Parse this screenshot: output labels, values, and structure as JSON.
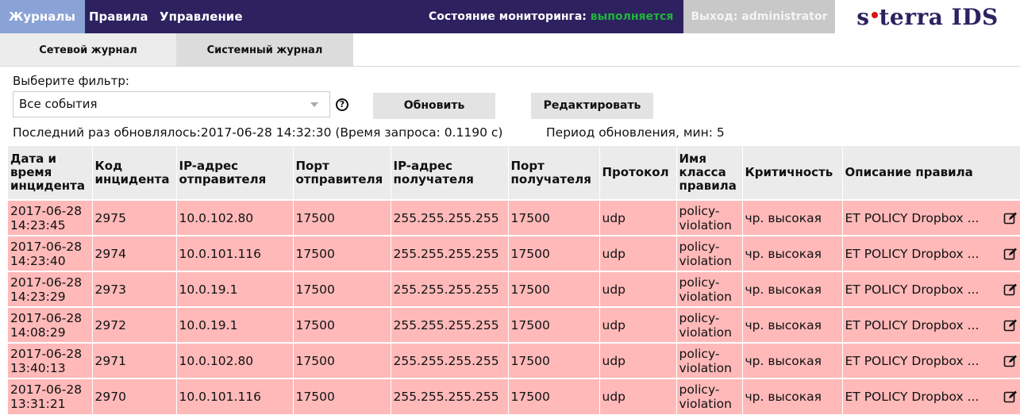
{
  "nav": {
    "items": [
      {
        "label": "Журналы"
      },
      {
        "label": "Правила"
      },
      {
        "label": "Управление"
      }
    ],
    "status_label": "Состояние мониторинга:",
    "status_value": "выполняется",
    "status_color": "#1fb53a",
    "logout": "Выход: administrator",
    "brand_color": "#2d2160"
  },
  "logo": {
    "left": "s",
    "right": "terra IDS"
  },
  "tabs": [
    {
      "label": "Сетевой журнал"
    },
    {
      "label": "Системный журнал"
    }
  ],
  "filter": {
    "label": "Выберите фильтр:",
    "selected": "Все события",
    "help_icon": "?",
    "refresh_button": "Обновить",
    "edit_button": "Редактировать"
  },
  "info": {
    "last_updated": "Последний раз обновлялось:2017-06-28 14:32:30 (Время запроса: 0.1190 с)",
    "period": "Период обновления, мин: 5"
  },
  "table": {
    "headers": [
      "Дата и время инцидента",
      "Код инцидента",
      "IP-адрес отправителя",
      "Порт отправителя",
      "IP-адрес получателя",
      "Порт получателя",
      "Протокол",
      "Имя класса правила",
      "Критичность",
      "Описание правила"
    ],
    "row_color": "#ffb9b9",
    "rows": [
      {
        "date": "2017-06-28",
        "time": "14:23:45",
        "code": "2975",
        "src_ip": "10.0.102.80",
        "src_port": "17500",
        "dst_ip": "255.255.255.255",
        "dst_port": "17500",
        "proto": "udp",
        "class1": "policy-",
        "class2": "violation",
        "severity": "чр. высокая",
        "descr": "ET POLICY Dropbox ..."
      },
      {
        "date": "2017-06-28",
        "time": "14:23:40",
        "code": "2974",
        "src_ip": "10.0.101.116",
        "src_port": "17500",
        "dst_ip": "255.255.255.255",
        "dst_port": "17500",
        "proto": "udp",
        "class1": "policy-",
        "class2": "violation",
        "severity": "чр. высокая",
        "descr": "ET POLICY Dropbox ..."
      },
      {
        "date": "2017-06-28",
        "time": "14:23:29",
        "code": "2973",
        "src_ip": "10.0.19.1",
        "src_port": "17500",
        "dst_ip": "255.255.255.255",
        "dst_port": "17500",
        "proto": "udp",
        "class1": "policy-",
        "class2": "violation",
        "severity": "чр. высокая",
        "descr": "ET POLICY Dropbox ..."
      },
      {
        "date": "2017-06-28",
        "time": "14:08:29",
        "code": "2972",
        "src_ip": "10.0.19.1",
        "src_port": "17500",
        "dst_ip": "255.255.255.255",
        "dst_port": "17500",
        "proto": "udp",
        "class1": "policy-",
        "class2": "violation",
        "severity": "чр. высокая",
        "descr": "ET POLICY Dropbox ..."
      },
      {
        "date": "2017-06-28",
        "time": "13:40:13",
        "code": "2971",
        "src_ip": "10.0.102.80",
        "src_port": "17500",
        "dst_ip": "255.255.255.255",
        "dst_port": "17500",
        "proto": "udp",
        "class1": "policy-",
        "class2": "violation",
        "severity": "чр. высокая",
        "descr": "ET POLICY Dropbox ..."
      },
      {
        "date": "2017-06-28",
        "time": "13:31:21",
        "code": "2970",
        "src_ip": "10.0.101.116",
        "src_port": "17500",
        "dst_ip": "255.255.255.255",
        "dst_port": "17500",
        "proto": "udp",
        "class1": "policy-",
        "class2": "violation",
        "severity": "чр. высокая",
        "descr": "ET POLICY Dropbox ..."
      }
    ]
  }
}
